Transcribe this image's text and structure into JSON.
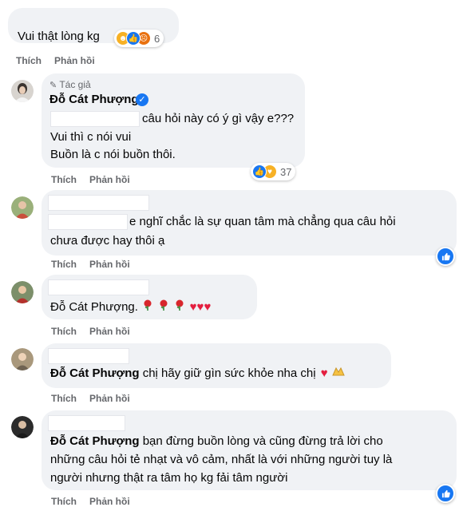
{
  "comments": [
    {
      "text": "Vui thật lòng kg",
      "reactions": [
        "haha",
        "like",
        "angry"
      ],
      "reaction_count": "6",
      "actions": [
        "Thích",
        "Phản hồi"
      ]
    },
    {
      "author_badge": "Tác giả",
      "author": "Đỗ Cát Phượng",
      "lines": [
        "câu hỏi này có ý gì vậy e???",
        "Vui thì c nói vui",
        "Buồn là c nói buồn thôi."
      ],
      "reactions": [
        "like",
        "care"
      ],
      "reaction_count": "37",
      "actions": [
        "Thích",
        "Phản hồi"
      ]
    },
    {
      "lines": [
        "e nghĩ chắc là sự quan tâm mà chẳng qua câu hỏi",
        "chưa được hay thôi ạ"
      ],
      "actions": [
        "Thích",
        "Phản hồi"
      ]
    },
    {
      "mention": "Đỗ Cát Phượng",
      "text": ".",
      "emoji": [
        "rose",
        "rose",
        "rose",
        "heart",
        "heart",
        "heart"
      ],
      "actions": [
        "Thích"
      ]
    },
    {
      "mention": "Đỗ Cát Phượng",
      "text": " chị hãy giữ gìn sức khỏe nha chị",
      "emoji": [
        "heart",
        "pray"
      ],
      "actions": [
        "Thích",
        "Phản hồi"
      ]
    },
    {
      "mention": "Đỗ Cát Phượng",
      "lines": [
        " bạn đừng buồn lòng và cũng đừng trả lời cho",
        "những câu hỏi tẻ nhạt và vô cảm, nhất là với những người tuy là",
        "người nhưng thật ra tâm họ kg fải tâm người"
      ],
      "actions": [
        "Thích",
        "Phản hồi"
      ]
    }
  ],
  "colors": {
    "bubble": "#f0f2f5",
    "like_blue": "#1877f2",
    "heart_red": "#e41e3f",
    "verified_blue": "#1877f2"
  }
}
